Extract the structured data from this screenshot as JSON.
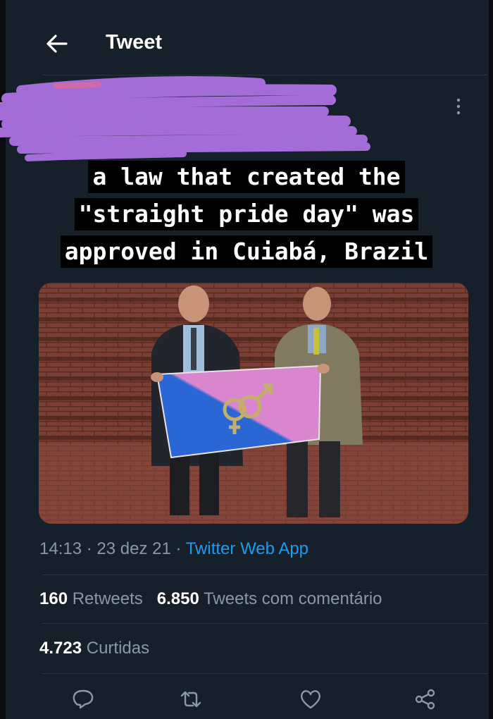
{
  "header": {
    "title": "Tweet",
    "back_icon": "arrow-left-icon"
  },
  "more_icon": "vertical-ellipsis-icon",
  "caption": [
    "a law that created the",
    "\"straight pride day\" was",
    "approved in Cuiabá, Brazil"
  ],
  "meta": {
    "time": "14:13",
    "sep1": " · ",
    "date": "23 dez 21",
    "sep2": " · ",
    "source": "Twitter Web App"
  },
  "stats": {
    "retweets_count": "160",
    "retweets_label": "Retweets",
    "quotes_count": "6.850",
    "quotes_label": "Tweets com comentário",
    "likes_count": "4.723",
    "likes_label": "Curtidas"
  },
  "actions": [
    "reply-icon",
    "retweet-icon",
    "like-icon",
    "share-icon"
  ],
  "colors": {
    "background": "#15202b",
    "text": "#ffffff",
    "secondary": "#8899a6",
    "link": "#1d9bf0",
    "scribble": "#a36cd6"
  }
}
